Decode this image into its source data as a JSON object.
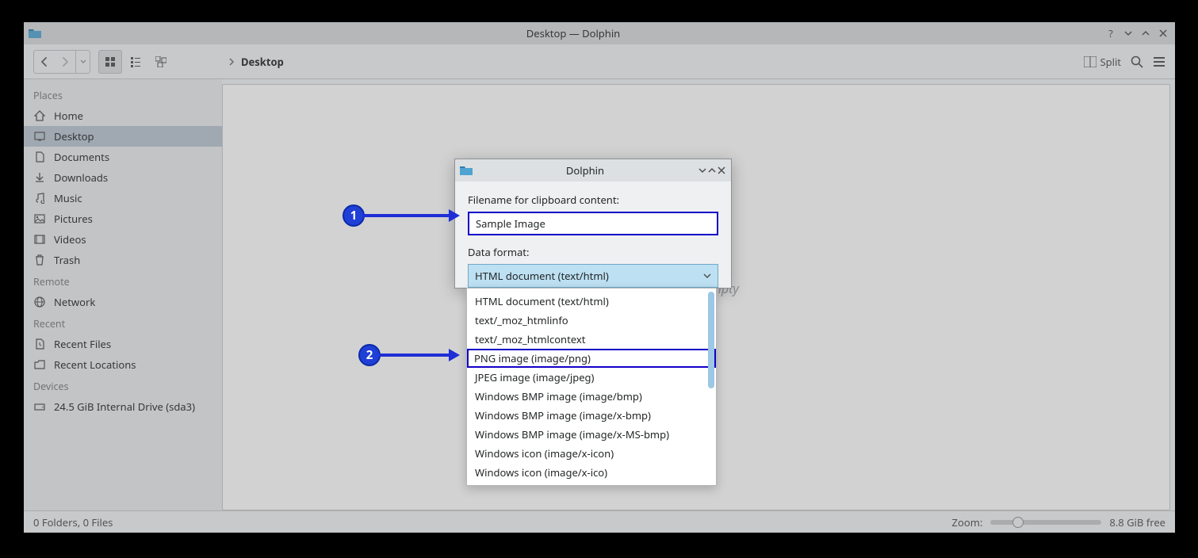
{
  "window": {
    "title": "Desktop — Dolphin",
    "breadcrumb_current": "Desktop",
    "split_label": "Split",
    "empty_hint": "Folder is empty"
  },
  "sidebar": {
    "sections": {
      "places": "Places",
      "remote": "Remote",
      "recent": "Recent",
      "devices": "Devices"
    },
    "items": {
      "home": "Home",
      "desktop": "Desktop",
      "documents": "Documents",
      "downloads": "Downloads",
      "music": "Music",
      "pictures": "Pictures",
      "videos": "Videos",
      "trash": "Trash",
      "network": "Network",
      "recent_files": "Recent Files",
      "recent_locations": "Recent Locations",
      "drive": "24.5 GiB Internal Drive (sda3)"
    }
  },
  "statusbar": {
    "items_text": "0 Folders, 0 Files",
    "zoom_label": "Zoom:",
    "free_space": "8.8 GiB free"
  },
  "dialog": {
    "title": "Dolphin",
    "filename_label": "Filename for clipboard content:",
    "filename_value": "Sample Image",
    "format_label": "Data format:",
    "combo_selected": "HTML document (text/html)",
    "options": [
      "HTML document (text/html)",
      "text/_moz_htmlinfo",
      "text/_moz_htmlcontext",
      "PNG image (image/png)",
      "JPEG image (image/jpeg)",
      "Windows BMP image (image/bmp)",
      "Windows BMP image (image/x-bmp)",
      "Windows BMP image (image/x-MS-bmp)",
      "Windows icon (image/x-icon)",
      "Windows icon (image/x-ico)"
    ],
    "highlight_index": 3
  },
  "annotations": {
    "a1": "1",
    "a2": "2"
  }
}
